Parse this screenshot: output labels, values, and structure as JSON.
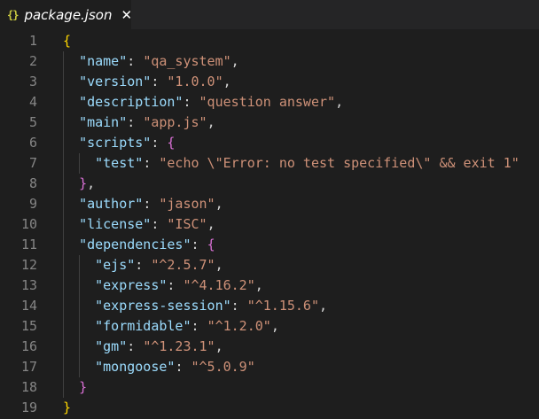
{
  "tab": {
    "icon": "{}",
    "title": "package.json",
    "close": "✕"
  },
  "lines": [
    {
      "n": "1",
      "tokens": [
        {
          "t": "{",
          "c": "b1"
        }
      ]
    },
    {
      "n": "2",
      "tokens": [
        {
          "t": "  "
        },
        {
          "t": "\"name\"",
          "c": "k"
        },
        {
          "t": ": ",
          "c": "p"
        },
        {
          "t": "\"qa_system\"",
          "c": "s"
        },
        {
          "t": ",",
          "c": "p"
        }
      ]
    },
    {
      "n": "3",
      "tokens": [
        {
          "t": "  "
        },
        {
          "t": "\"version\"",
          "c": "k"
        },
        {
          "t": ": ",
          "c": "p"
        },
        {
          "t": "\"1.0.0\"",
          "c": "s"
        },
        {
          "t": ",",
          "c": "p"
        }
      ]
    },
    {
      "n": "4",
      "tokens": [
        {
          "t": "  "
        },
        {
          "t": "\"description\"",
          "c": "k"
        },
        {
          "t": ": ",
          "c": "p"
        },
        {
          "t": "\"question answer\"",
          "c": "s"
        },
        {
          "t": ",",
          "c": "p"
        }
      ]
    },
    {
      "n": "5",
      "tokens": [
        {
          "t": "  "
        },
        {
          "t": "\"main\"",
          "c": "k"
        },
        {
          "t": ": ",
          "c": "p"
        },
        {
          "t": "\"app.js\"",
          "c": "s"
        },
        {
          "t": ",",
          "c": "p"
        }
      ]
    },
    {
      "n": "6",
      "tokens": [
        {
          "t": "  "
        },
        {
          "t": "\"scripts\"",
          "c": "k"
        },
        {
          "t": ": ",
          "c": "p"
        },
        {
          "t": "{",
          "c": "b2"
        }
      ]
    },
    {
      "n": "7",
      "tokens": [
        {
          "t": "    "
        },
        {
          "t": "\"test\"",
          "c": "k"
        },
        {
          "t": ": ",
          "c": "p"
        },
        {
          "t": "\"echo \\\"Error: no test specified\\\" && exit 1\"",
          "c": "s"
        }
      ]
    },
    {
      "n": "8",
      "tokens": [
        {
          "t": "  "
        },
        {
          "t": "}",
          "c": "b2"
        },
        {
          "t": ",",
          "c": "p"
        }
      ]
    },
    {
      "n": "9",
      "tokens": [
        {
          "t": "  "
        },
        {
          "t": "\"author\"",
          "c": "k"
        },
        {
          "t": ": ",
          "c": "p"
        },
        {
          "t": "\"jason\"",
          "c": "s"
        },
        {
          "t": ",",
          "c": "p"
        }
      ]
    },
    {
      "n": "10",
      "tokens": [
        {
          "t": "  "
        },
        {
          "t": "\"license\"",
          "c": "k"
        },
        {
          "t": ": ",
          "c": "p"
        },
        {
          "t": "\"ISC\"",
          "c": "s"
        },
        {
          "t": ",",
          "c": "p"
        }
      ]
    },
    {
      "n": "11",
      "tokens": [
        {
          "t": "  "
        },
        {
          "t": "\"dependencies\"",
          "c": "k"
        },
        {
          "t": ": ",
          "c": "p"
        },
        {
          "t": "{",
          "c": "b2"
        }
      ]
    },
    {
      "n": "12",
      "tokens": [
        {
          "t": "    "
        },
        {
          "t": "\"ejs\"",
          "c": "k"
        },
        {
          "t": ": ",
          "c": "p"
        },
        {
          "t": "\"^2.5.7\"",
          "c": "s"
        },
        {
          "t": ",",
          "c": "p"
        }
      ]
    },
    {
      "n": "13",
      "tokens": [
        {
          "t": "    "
        },
        {
          "t": "\"express\"",
          "c": "k"
        },
        {
          "t": ": ",
          "c": "p"
        },
        {
          "t": "\"^4.16.2\"",
          "c": "s"
        },
        {
          "t": ",",
          "c": "p"
        }
      ]
    },
    {
      "n": "14",
      "tokens": [
        {
          "t": "    "
        },
        {
          "t": "\"express-session\"",
          "c": "k"
        },
        {
          "t": ": ",
          "c": "p"
        },
        {
          "t": "\"^1.15.6\"",
          "c": "s"
        },
        {
          "t": ",",
          "c": "p"
        }
      ]
    },
    {
      "n": "15",
      "tokens": [
        {
          "t": "    "
        },
        {
          "t": "\"formidable\"",
          "c": "k"
        },
        {
          "t": ": ",
          "c": "p"
        },
        {
          "t": "\"^1.2.0\"",
          "c": "s"
        },
        {
          "t": ",",
          "c": "p"
        }
      ]
    },
    {
      "n": "16",
      "tokens": [
        {
          "t": "    "
        },
        {
          "t": "\"gm\"",
          "c": "k"
        },
        {
          "t": ": ",
          "c": "p"
        },
        {
          "t": "\"^1.23.1\"",
          "c": "s"
        },
        {
          "t": ",",
          "c": "p"
        }
      ]
    },
    {
      "n": "17",
      "tokens": [
        {
          "t": "    "
        },
        {
          "t": "\"mongoose\"",
          "c": "k"
        },
        {
          "t": ": ",
          "c": "p"
        },
        {
          "t": "\"^5.0.9\"",
          "c": "s"
        }
      ]
    },
    {
      "n": "18",
      "tokens": [
        {
          "t": "  "
        },
        {
          "t": "}",
          "c": "b2"
        }
      ]
    },
    {
      "n": "19",
      "tokens": [
        {
          "t": "}",
          "c": "b1"
        }
      ]
    }
  ],
  "colors": {
    "background": "#1e1e1e",
    "key": "#9cdcfe",
    "string": "#ce9178",
    "punctuation": "#d4d4d4",
    "bracket_level1": "#ffd700",
    "bracket_level2": "#da70d6",
    "line_number": "#858585"
  }
}
